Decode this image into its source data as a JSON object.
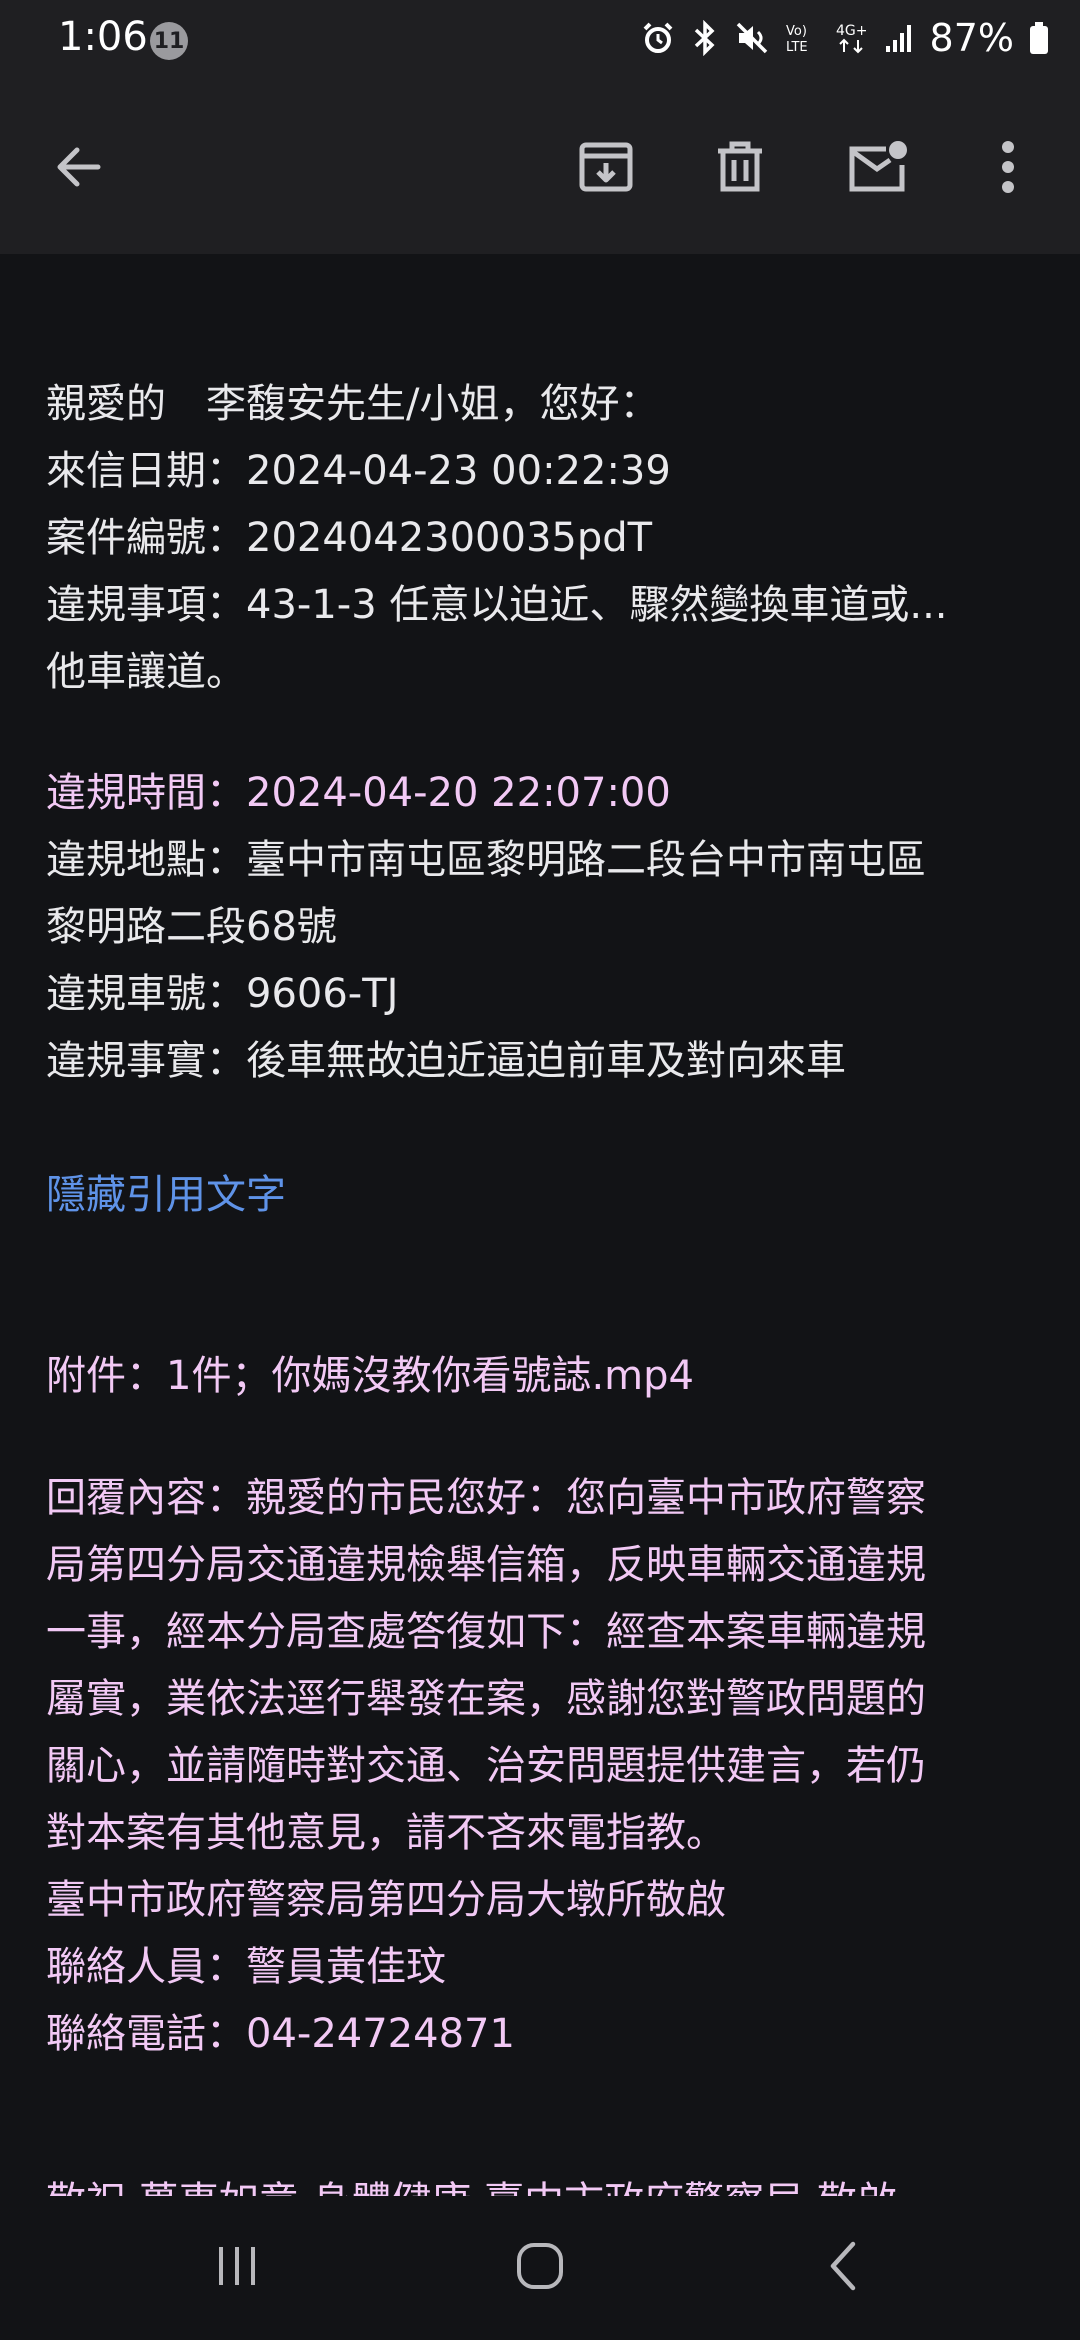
{
  "status_bar": {
    "time": "1:06",
    "notification_count": "11",
    "battery_percent": "87%",
    "icons": [
      "alarm-icon",
      "bluetooth-icon",
      "mute-icon",
      "volte-icon",
      "4g-plus-icon",
      "signal-icon",
      "battery-icon"
    ]
  },
  "toolbar": {
    "icons": [
      "back-arrow-icon",
      "archive-icon",
      "delete-icon",
      "mark-unread-icon",
      "more-options-icon"
    ]
  },
  "email": {
    "greeting": "親愛的　李馥安先生/小姐，您好：",
    "date_line": "來信日期：2024-04-23 00:22:39",
    "case_line": "案件編號：2024042300035pdT",
    "violation_item_line1": "違規事項：43-1-3 任意以迫近、驟然變換車道或...",
    "violation_item_line2": "他車讓道。",
    "violation_time": "違規時間：2024-04-20 22:07:00",
    "location_line1": "違規地點：臺中市南屯區黎明路二段台中市南屯區",
    "location_line2": "黎明路二段68號",
    "plate_line": "違規車號：9606-TJ",
    "fact_line": "違規事實：後車無故迫近逼迫前車及對向來車",
    "hide_quoted": "隱藏引用文字",
    "attachment_line": "附件：1件；你媽沒教你看號誌.mp4",
    "reply_lines": [
      "回覆內容：親愛的市民您好：您向臺中市政府警察",
      "局第四分局交通違規檢舉信箱，反映車輛交通違規",
      "一事，經本分局查處答復如下：經查本案車輛違規",
      "屬實，業依法逕行舉發在案，感謝您對警政問題的",
      "關心，並請隨時對交通、治安問題提供建言，若仍",
      "對本案有其他意見，請不吝來電指教。",
      "臺中市政府警察局第四分局大墩所敬啟",
      "聯絡人員：警員黃佳玟",
      "聯絡電話：04-24724871"
    ],
    "cut_off_line": "敬祝 萬事如意 身體健康 臺中市政府警察局 敬啟"
  },
  "navigation": {
    "icons": [
      "recent-apps-icon",
      "home-icon",
      "back-icon"
    ]
  }
}
